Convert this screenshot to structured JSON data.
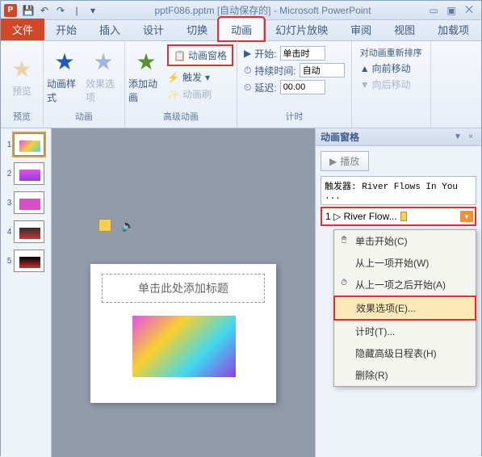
{
  "titlebar": {
    "app_icon": "P",
    "title": "pptF086.pptm [自动保存的] - Microsoft PowerPoint"
  },
  "tabs": {
    "file": "文件",
    "home": "开始",
    "insert": "插入",
    "design": "设计",
    "transitions": "切换",
    "animations": "动画",
    "slideshow": "幻灯片放映",
    "review": "审阅",
    "view": "视图",
    "addins": "加载项"
  },
  "ribbon": {
    "preview": {
      "label": "预览",
      "group": "预览"
    },
    "animation": {
      "styles": "动画样式",
      "options": "效果选项",
      "group": "动画"
    },
    "advanced": {
      "add": "添加动画",
      "pane": "动画窗格",
      "trigger": "触发",
      "painter": "动画刷",
      "group": "高级动画"
    },
    "timing": {
      "start_label": "开始:",
      "start_value": "单击时",
      "duration_label": "持续时间:",
      "duration_value": "自动",
      "delay_label": "延迟:",
      "delay_value": "00.00",
      "group": "计时"
    },
    "reorder": {
      "title": "对动画重新排序",
      "forward": "向前移动",
      "backward": "向后移动"
    }
  },
  "thumbs": [
    "1",
    "2",
    "3",
    "4",
    "5"
  ],
  "slide": {
    "title_placeholder": "单击此处添加标题"
  },
  "animpane": {
    "title": "动画窗格",
    "play": "播放",
    "trigger": "触发器: River Flows In You ...",
    "item": "1 ▷ River Flow...",
    "menu": {
      "click": "单击开始(C)",
      "withprev": "从上一项开始(W)",
      "afterprev": "从上一项之后开始(A)",
      "effect": "效果选项(E)...",
      "timing": "计时(T)...",
      "hide": "隐藏高级日程表(H)",
      "remove": "删除(R)"
    }
  }
}
